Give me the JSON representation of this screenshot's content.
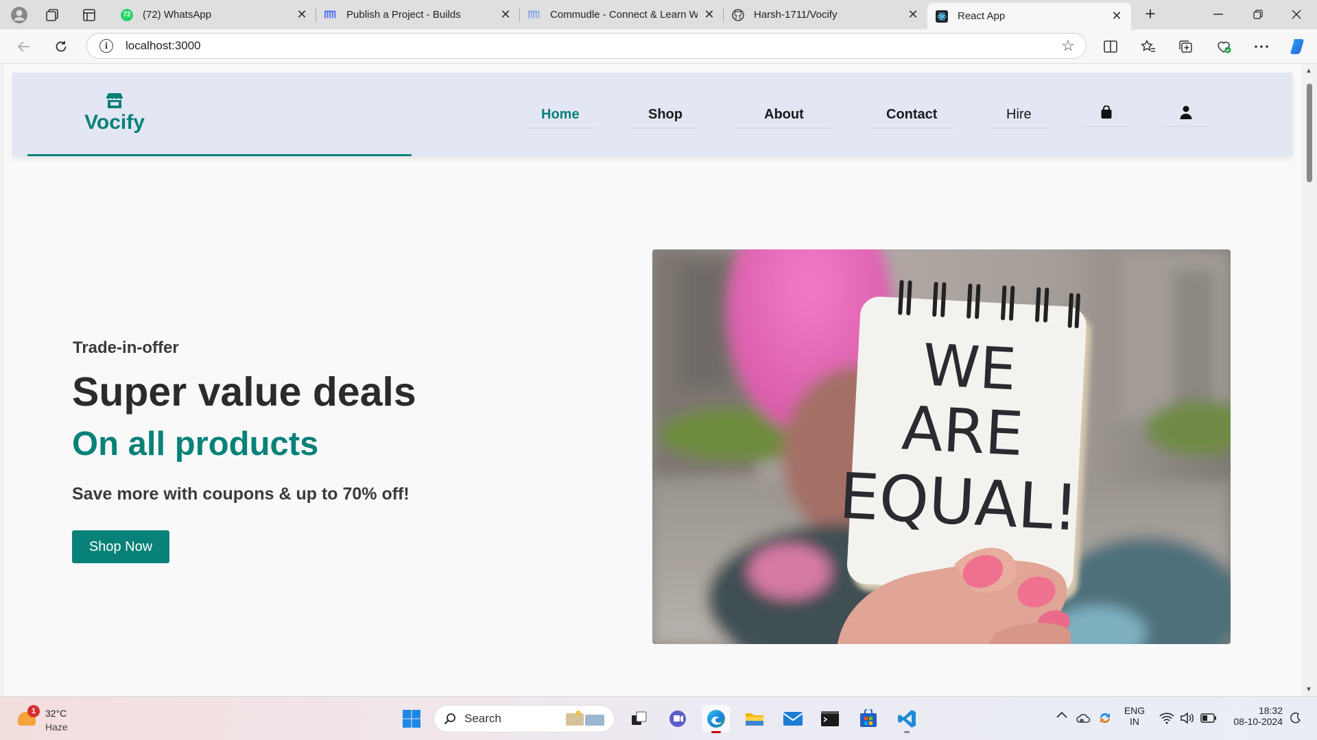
{
  "browser": {
    "tabs": [
      {
        "title": "(72) WhatsApp",
        "icon": "whatsapp-icon",
        "badge": "72"
      },
      {
        "title": "Publish a Project - Builds",
        "icon": "builds-icon"
      },
      {
        "title": "Commudle - Connect & Learn Wi",
        "icon": "commudle-icon"
      },
      {
        "title": "Harsh-1711/Vocify",
        "icon": "github-icon"
      },
      {
        "title": "React App",
        "icon": "react-icon"
      }
    ],
    "url": "localhost:3000"
  },
  "site": {
    "logo_text": "Vocify",
    "nav": [
      {
        "label": "Home"
      },
      {
        "label": "Shop"
      },
      {
        "label": "About"
      },
      {
        "label": "Contact"
      },
      {
        "label": "Hire"
      }
    ],
    "icons": [
      "shopping-bag-icon",
      "user-icon"
    ],
    "accent_color": "#088178",
    "header_bg": "#e3e6f3"
  },
  "hero": {
    "subtitle": "Trade-in-offer",
    "title": "Super value deals",
    "accent_line": "On all products",
    "description": "Save more with coupons & up to 70% off!",
    "button_label": "Shop Now"
  },
  "hero_image": {
    "sign_lines": [
      "WE",
      "ARE",
      "EQUAL!"
    ]
  },
  "taskbar": {
    "weather": {
      "temp": "32°C",
      "condition": "Haze",
      "badge": "1"
    },
    "search_label": "Search",
    "lang_top": "ENG",
    "lang_bottom": "IN",
    "time": "18:32",
    "date": "08-10-2024"
  }
}
